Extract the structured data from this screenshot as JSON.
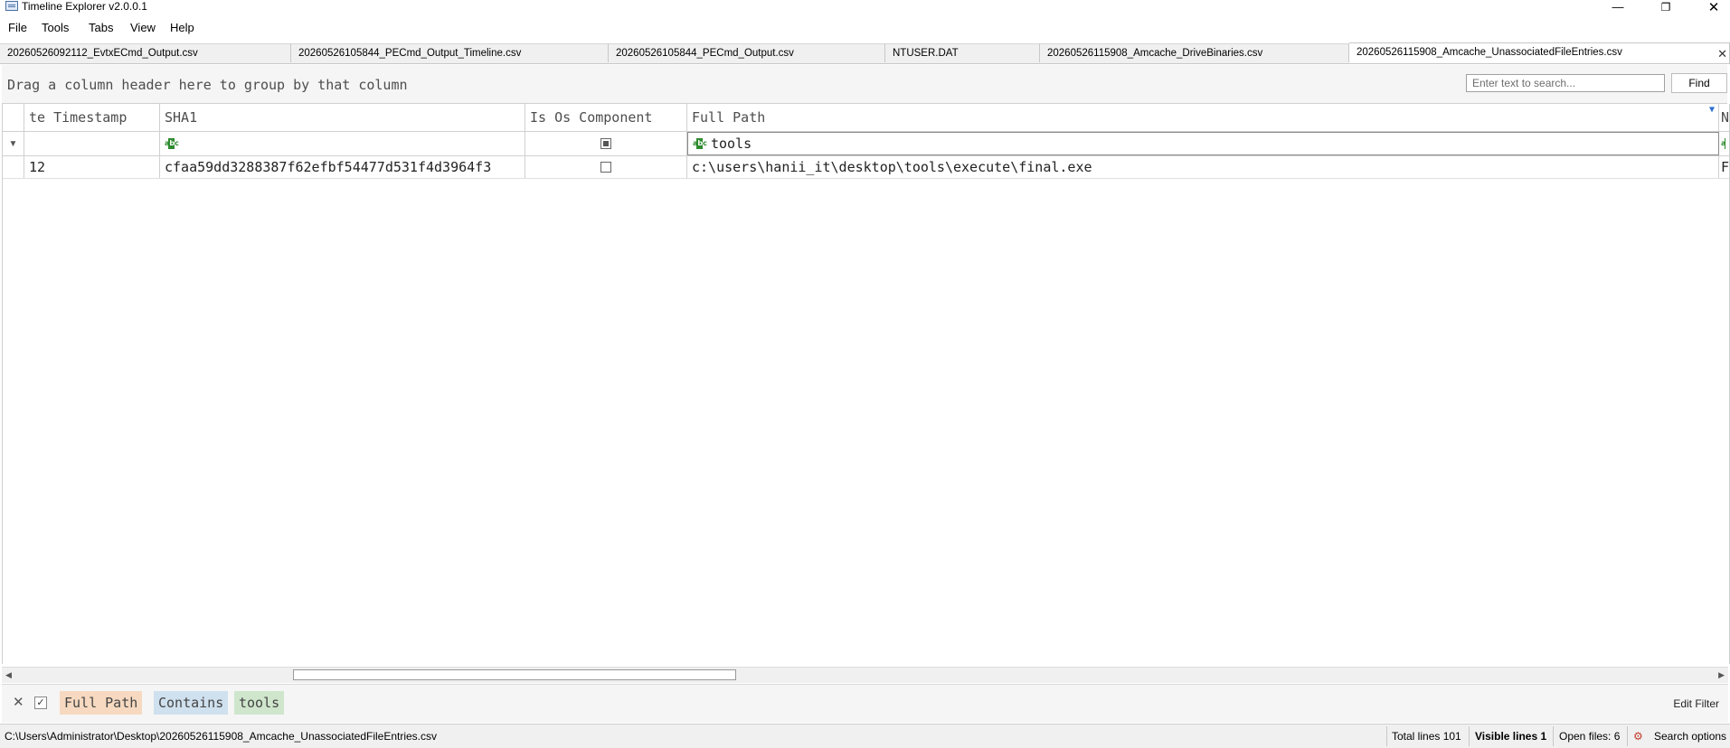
{
  "window": {
    "title": "Timeline Explorer v2.0.0.1",
    "minimize_glyph": "—",
    "restore_glyph": "❐",
    "close_glyph": "✕"
  },
  "menu": {
    "items": [
      {
        "label": "File"
      },
      {
        "label": "Tools"
      },
      {
        "label": "Tabs"
      },
      {
        "label": "View"
      },
      {
        "label": "Help"
      }
    ]
  },
  "tabs": {
    "items": [
      {
        "label": "20260526092112_EvtxECmd_Output.csv"
      },
      {
        "label": "20260526105844_PECmd_Output_Timeline.csv"
      },
      {
        "label": "20260526105844_PECmd_Output.csv"
      },
      {
        "label": "NTUSER.DAT"
      },
      {
        "label": "20260526115908_Amcache_DriveBinaries.csv"
      },
      {
        "label": "20260526115908_Amcache_UnassociatedFileEntries.csv",
        "active": true
      }
    ],
    "close_glyph": "✕"
  },
  "toolbar": {
    "group_hint": "Drag a column header here to group by that column",
    "search_placeholder": "Enter text to search...",
    "find_label": "Find"
  },
  "grid": {
    "columns": [
      {
        "label": "te Timestamp"
      },
      {
        "label": "SHA1"
      },
      {
        "label": "Is Os Component"
      },
      {
        "label": "Full Path"
      },
      {
        "label": "N"
      }
    ],
    "filter_row": {
      "full_path_filter": "tools"
    },
    "rows": [
      {
        "timestamp": "12",
        "sha1": "cfaa59dd3288387f62efbf54477d531f4d3964f3",
        "is_os_component": false,
        "full_path": "c:\\users\\hanii_it\\desktop\\tools\\execute\\final.exe",
        "next": "F"
      }
    ]
  },
  "filter_bar": {
    "chips": [
      {
        "label": "Full Path",
        "color": "#f6d9c0"
      },
      {
        "label": "Contains",
        "color": "#cfe0ee"
      },
      {
        "label": "tools",
        "color": "#cfe6cc"
      }
    ],
    "edit_filter_label": "Edit Filter"
  },
  "status": {
    "path": "C:\\Users\\Administrator\\Desktop\\20260526115908_Amcache_UnassociatedFileEntries.csv",
    "total_lines": "Total lines 101",
    "visible_lines": "Visible lines 1",
    "open_files": "Open files: 6",
    "search_options": "Search options"
  }
}
